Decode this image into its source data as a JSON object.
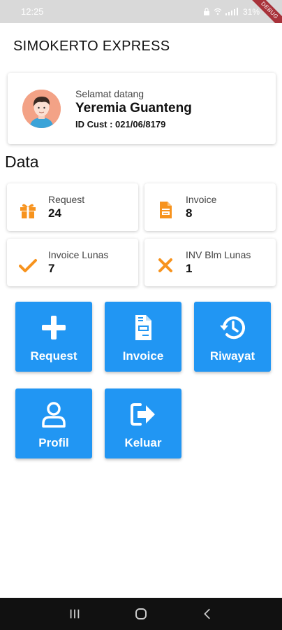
{
  "status_bar": {
    "time": "12:25",
    "battery": "31%",
    "debug_banner": "DEBUG"
  },
  "app_bar": {
    "title": "SIMOKERTO EXPRESS"
  },
  "profile": {
    "greeting": "Selamat datang",
    "name": "Yeremia Guanteng",
    "customer_id": "ID Cust : 021/06/8179"
  },
  "section_title": "Data",
  "stats": [
    {
      "label": "Request",
      "value": "24",
      "icon": "gift-icon"
    },
    {
      "label": "Invoice",
      "value": "8",
      "icon": "invoice-icon"
    },
    {
      "label": "Invoice Lunas",
      "value": "7",
      "icon": "check-icon"
    },
    {
      "label": "INV Blm Lunas",
      "value": "1",
      "icon": "close-icon"
    }
  ],
  "menu": [
    {
      "label": "Request",
      "icon": "plus-icon"
    },
    {
      "label": "Invoice",
      "icon": "invoice-icon"
    },
    {
      "label": "Riwayat",
      "icon": "history-icon"
    },
    {
      "label": "Profil",
      "icon": "user-icon"
    },
    {
      "label": "Keluar",
      "icon": "logout-icon"
    }
  ],
  "colors": {
    "primary": "#2196f3",
    "accent": "#f7931e",
    "status_bar": "#d9d9d9",
    "nav_bar": "#111111"
  }
}
